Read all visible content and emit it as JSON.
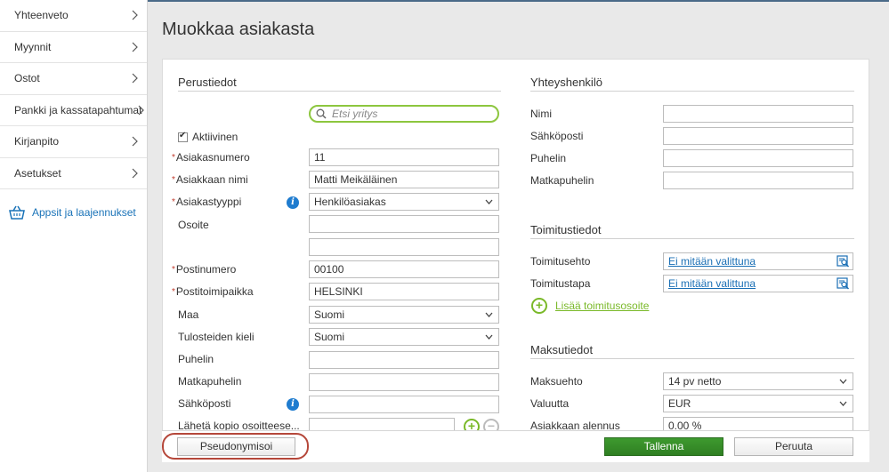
{
  "sidebar": {
    "items": [
      {
        "label": "Yhteenveto"
      },
      {
        "label": "Myynnit"
      },
      {
        "label": "Ostot"
      },
      {
        "label": "Pankki ja kassatapahtumat"
      },
      {
        "label": "Kirjanpito"
      },
      {
        "label": "Asetukset"
      }
    ],
    "apps_label": "Appsit ja laajennukset"
  },
  "page": {
    "title": "Muokkaa asiakasta"
  },
  "basic": {
    "section_title": "Perustiedot",
    "search_placeholder": "Etsi yritys",
    "active_label": "Aktiivinen",
    "customer_number_label": "Asiakasnumero",
    "customer_number": "11",
    "customer_name_label": "Asiakkaan nimi",
    "customer_name": "Matti Meikäläinen",
    "customer_type_label": "Asiakastyyppi",
    "customer_type": "Henkilöasiakas",
    "address_label": "Osoite",
    "address1": "",
    "address2": "",
    "postal_code_label": "Postinumero",
    "postal_code": "00100",
    "city_label": "Postitoimipaikka",
    "city": "HELSINKI",
    "country_label": "Maa",
    "country": "Suomi",
    "print_lang_label": "Tulosteiden kieli",
    "print_lang": "Suomi",
    "phone_label": "Puhelin",
    "phone": "",
    "mobile_label": "Matkapuhelin",
    "mobile": "",
    "email_label": "Sähköposti",
    "email": "",
    "copy_label": "Lähetä kopio osoitteese...",
    "copy_value": ""
  },
  "contact": {
    "section_title": "Yhteyshenkilö",
    "name_label": "Nimi",
    "email_label": "Sähköposti",
    "phone_label": "Puhelin",
    "mobile_label": "Matkapuhelin"
  },
  "delivery": {
    "section_title": "Toimitustiedot",
    "terms_label": "Toimitusehto",
    "terms_value": "Ei mitään valittuna",
    "method_label": "Toimitustapa",
    "method_value": "Ei mitään valittuna",
    "add_address_label": "Lisää toimitusosoite"
  },
  "payment": {
    "section_title": "Maksutiedot",
    "terms_label": "Maksuehto",
    "terms_value": "14 pv netto",
    "currency_label": "Valuutta",
    "currency_value": "EUR",
    "discount_label": "Asiakkaan alennus",
    "discount_value": "0.00 %"
  },
  "footer": {
    "pseudonymize_label": "Pseudonymisoi",
    "save_label": "Tallenna",
    "cancel_label": "Peruuta"
  },
  "colors": {
    "accent_green": "#2f7f22",
    "link_blue": "#1a6fb5",
    "required_red": "#c0392b",
    "highlight_ring": "#b5473a"
  },
  "icons": [
    "chevron-right-icon",
    "shopping-basket-icon",
    "search-icon",
    "info-icon",
    "caret-down-icon",
    "lookup-icon",
    "plus-circle-icon",
    "minus-circle-icon"
  ]
}
